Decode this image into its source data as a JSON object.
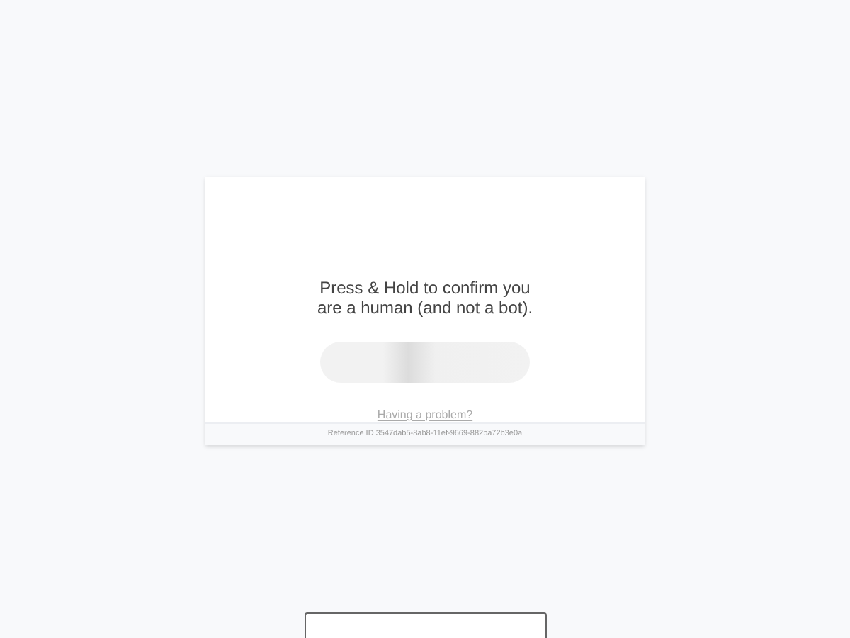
{
  "challenge": {
    "prompt": "Press & Hold to confirm you are a human (and not a bot).",
    "help_link": "Having a problem?",
    "reference": "Reference ID 3547dab5-8ab8-11ef-9669-882ba72b3e0a"
  }
}
